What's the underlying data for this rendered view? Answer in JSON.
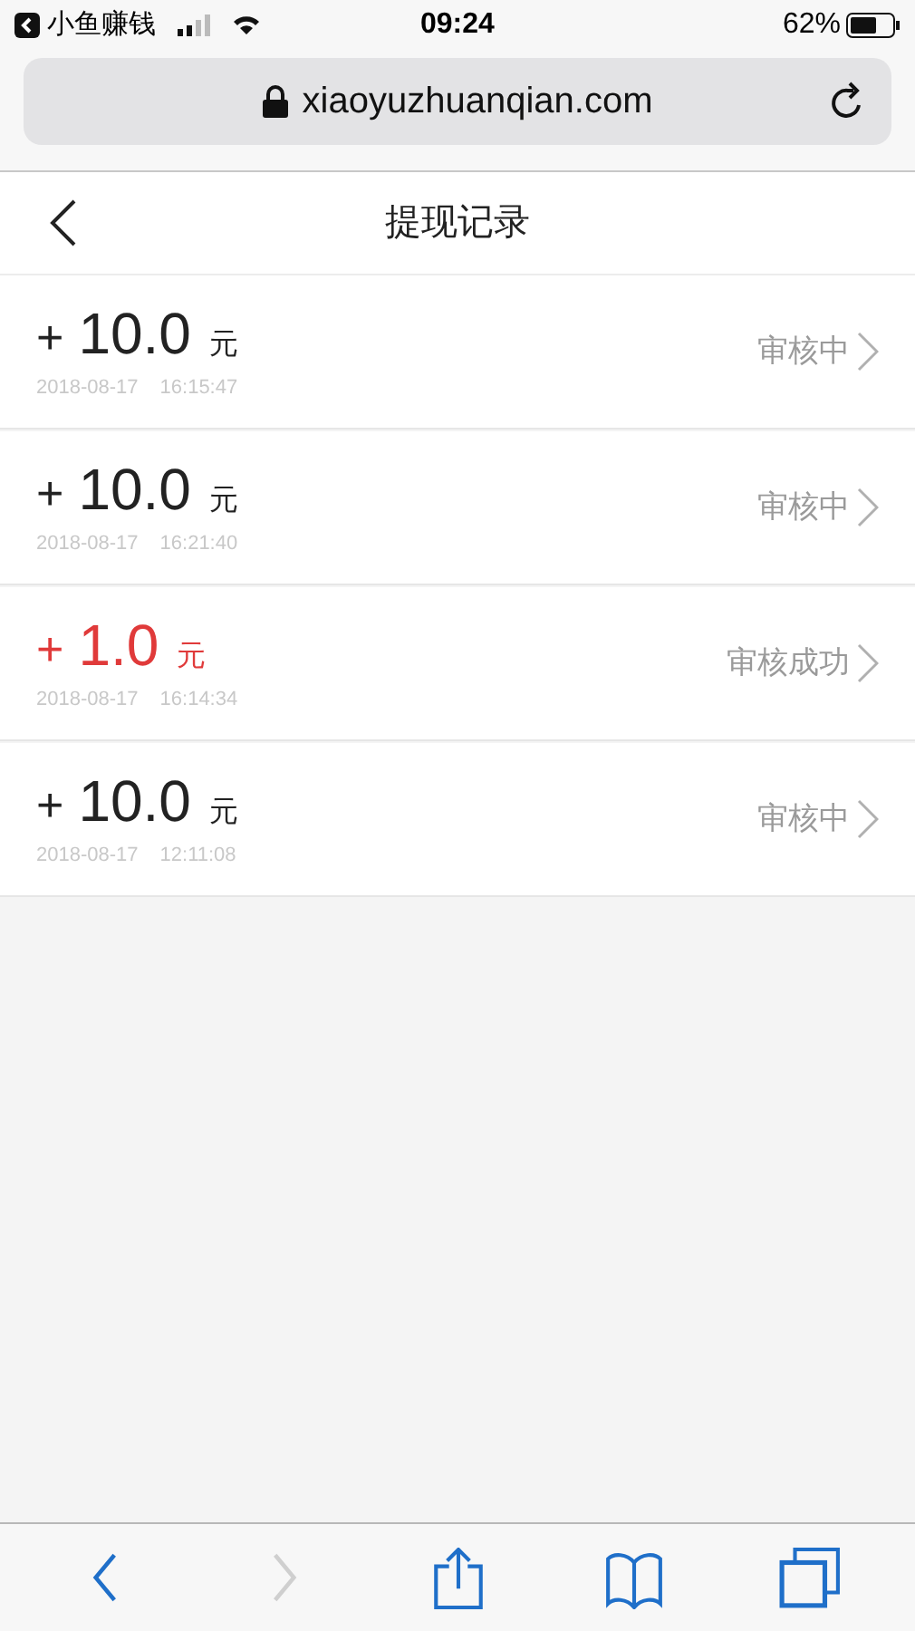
{
  "status_bar": {
    "back_app": "小鱼赚钱",
    "time": "09:24",
    "battery": "62%"
  },
  "address_bar": {
    "url": "xiaoyuzhuanqian.com"
  },
  "header": {
    "title": "提现记录"
  },
  "records": [
    {
      "sign": "+",
      "amount": "10.0",
      "unit": "元",
      "date": "2018-08-17",
      "time": "16:15:47",
      "status": "审核中",
      "kind": "pending"
    },
    {
      "sign": "+",
      "amount": "10.0",
      "unit": "元",
      "date": "2018-08-17",
      "time": "16:21:40",
      "status": "审核中",
      "kind": "pending"
    },
    {
      "sign": "+",
      "amount": "1.0",
      "unit": "元",
      "date": "2018-08-17",
      "time": "16:14:34",
      "status": "审核成功",
      "kind": "success"
    },
    {
      "sign": "+",
      "amount": "10.0",
      "unit": "元",
      "date": "2018-08-17",
      "time": "12:11:08",
      "status": "审核中",
      "kind": "pending"
    }
  ],
  "toolbar": [
    {
      "kind": "back",
      "disabled": false
    },
    {
      "kind": "forward",
      "disabled": true
    },
    {
      "kind": "share",
      "disabled": false
    },
    {
      "kind": "bookmarks",
      "disabled": false
    },
    {
      "kind": "tabs",
      "disabled": false
    }
  ]
}
